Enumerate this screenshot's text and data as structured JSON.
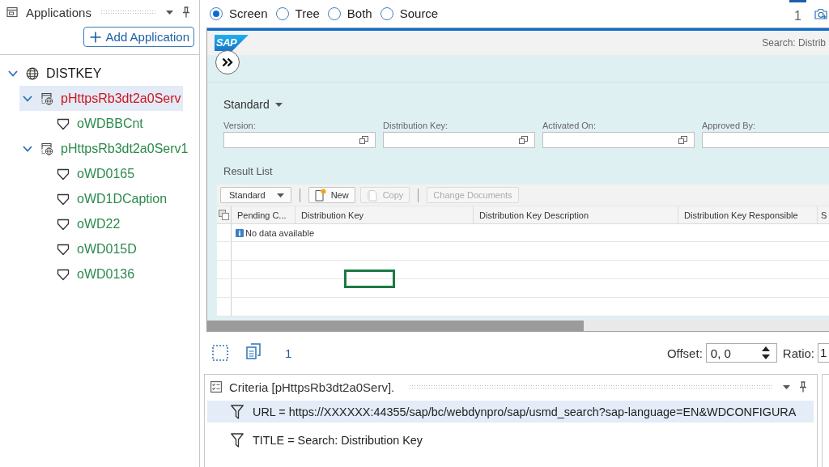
{
  "applications_panel": {
    "title": "Applications",
    "add_button": "Add Application",
    "tree": [
      {
        "kind": "application",
        "label": "DISTKEY",
        "selected": false,
        "expanded": true,
        "children": [
          {
            "kind": "page",
            "label": "pHttpsRb3dt2a0Serv",
            "selected": true,
            "expanded": true,
            "color": "#d0161f",
            "children": [
              {
                "kind": "element",
                "label": "oWDBBCnt",
                "selected": false,
                "color": "#2a8a4c"
              }
            ]
          },
          {
            "kind": "page",
            "label": "pHttpsRb3dt2a0Serv1",
            "selected": false,
            "expanded": true,
            "color": "#2a8a4c",
            "children": [
              {
                "kind": "element",
                "label": "oWD0165",
                "selected": false,
                "color": "#2a8a4c"
              },
              {
                "kind": "element",
                "label": "oWD1DCaption",
                "selected": false,
                "color": "#2a8a4c"
              },
              {
                "kind": "element",
                "label": "oWD22",
                "selected": false,
                "color": "#2a8a4c"
              },
              {
                "kind": "element",
                "label": "oWD015D",
                "selected": false,
                "color": "#2a8a4c"
              },
              {
                "kind": "element",
                "label": "oWD0136",
                "selected": false,
                "color": "#2a8a4c"
              }
            ]
          }
        ]
      }
    ]
  },
  "view_modes": [
    {
      "label": "Screen",
      "selected": true
    },
    {
      "label": "Tree",
      "selected": false
    },
    {
      "label": "Both",
      "selected": false
    },
    {
      "label": "Source",
      "selected": false
    }
  ],
  "page_tabs": [
    {
      "label": "1",
      "selected": true
    }
  ],
  "screen": {
    "logo": "SAP",
    "title": "Search: Distrib",
    "variant": "Standard",
    "fields": [
      {
        "label": "Version:",
        "value_help": true
      },
      {
        "label": "Distribution Key:",
        "value_help": true
      },
      {
        "label": "Activated On:",
        "value_help": true
      },
      {
        "label": "Approved By:"
      }
    ],
    "result_list": {
      "title": "Result List",
      "toolbar": [
        {
          "kind": "dropdown",
          "label": "Standard",
          "disabled": false
        },
        {
          "kind": "separator"
        },
        {
          "kind": "create",
          "label": "New",
          "disabled": false
        },
        {
          "kind": "copy",
          "label": "Copy",
          "disabled": true
        },
        {
          "kind": "separator"
        },
        {
          "kind": "plain",
          "label": "Change Documents",
          "disabled": true
        }
      ],
      "columns": [
        "Pending C...",
        "Distribution Key",
        "Distribution Key Description",
        "Distribution Key Responsible",
        "S"
      ],
      "empty_message": "No data available"
    }
  },
  "preview_toolbar": {
    "count": "1",
    "offset": {
      "label": "Offset:",
      "value": "0, 0"
    },
    "ratio": {
      "label": "Ratio:",
      "value": "1"
    }
  },
  "criteria": {
    "title": "Criteria [pHttpsRb3dt2a0Serv].",
    "rows": [
      {
        "text": "URL = https://XXXXXX:44355/sap/bc/webdynpro/sap/usmd_search?sap-language=EN&WDCONFIGURA",
        "selected": true
      },
      {
        "text": "TITLE = Search: Distribution Key",
        "selected": false
      }
    ]
  }
}
